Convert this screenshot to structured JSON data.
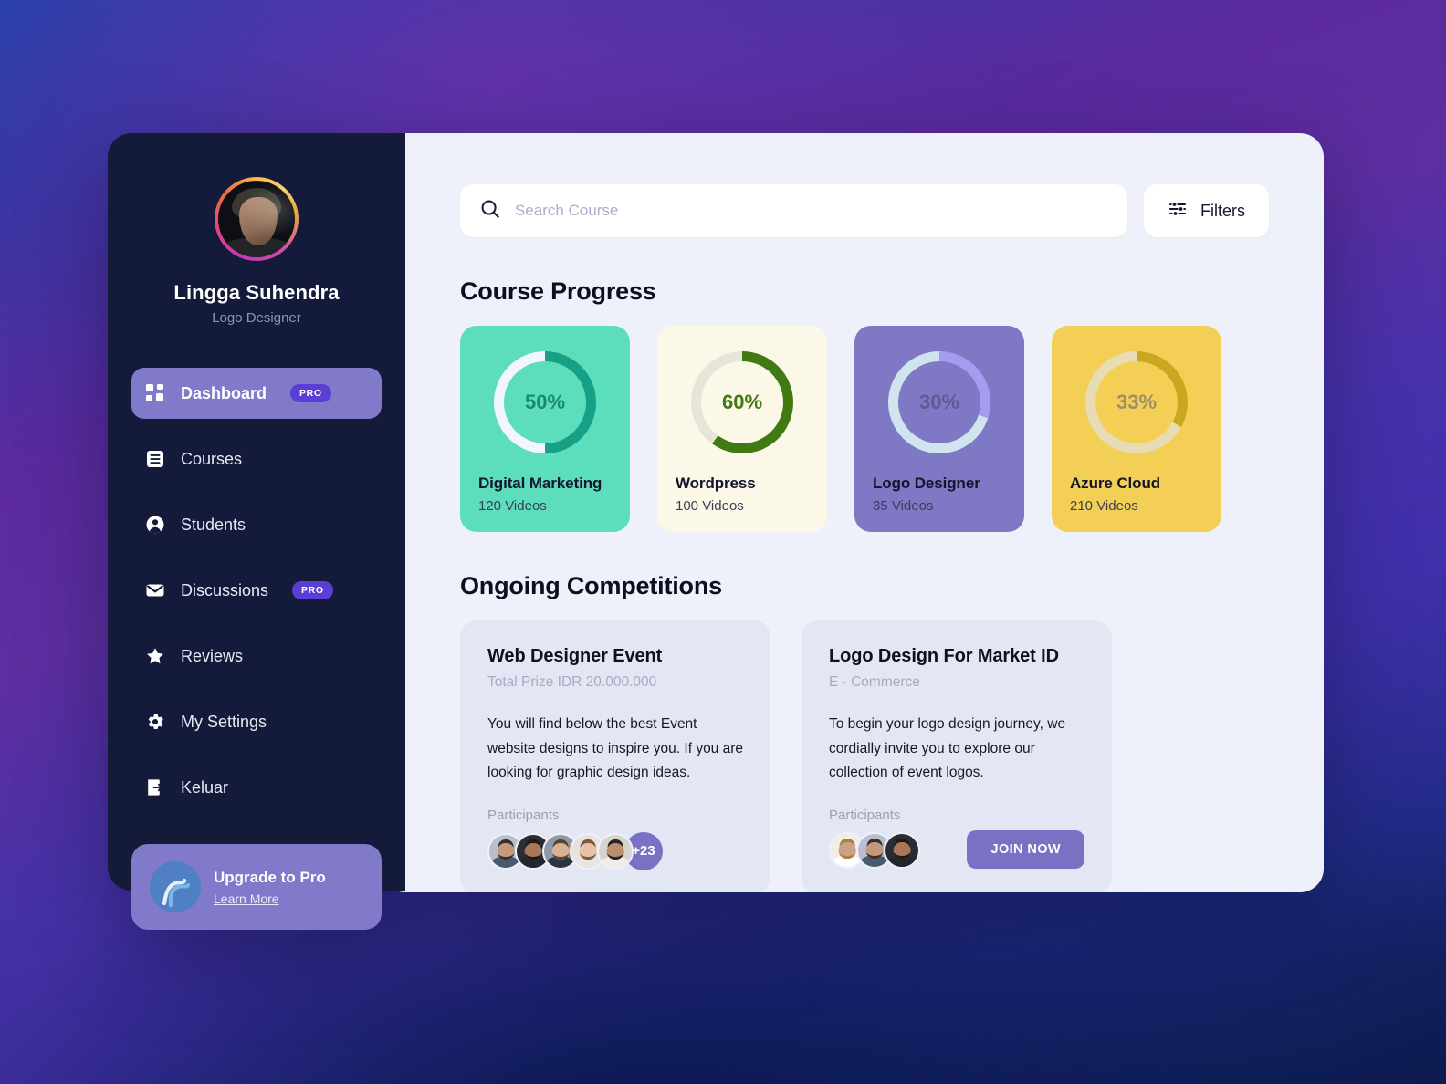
{
  "sidebar": {
    "profile": {
      "name": "Lingga Suhendra",
      "role": "Logo Designer",
      "avatar_icon": "user-avatar-photo"
    },
    "items": [
      {
        "label": "Dashboard",
        "icon": "grid-icon",
        "badge": "PRO",
        "active": true
      },
      {
        "label": "Courses",
        "icon": "list-icon",
        "badge": "",
        "active": false
      },
      {
        "label": "Students",
        "icon": "user-icon",
        "badge": "",
        "active": false
      },
      {
        "label": "Discussions",
        "icon": "envelope-icon",
        "badge": "PRO",
        "active": false
      },
      {
        "label": "Reviews",
        "icon": "star-icon",
        "badge": "",
        "active": false
      },
      {
        "label": "My Settings",
        "icon": "gear-icon",
        "badge": "",
        "active": false
      },
      {
        "label": "Keluar",
        "icon": "logout-icon",
        "badge": "",
        "active": false
      }
    ],
    "upgrade": {
      "title": "Upgrade to Pro",
      "link": "Learn More",
      "logo_icon": "wave-logo-icon"
    }
  },
  "topbar": {
    "search_placeholder": "Search Course",
    "search_value": "",
    "search_icon": "search-icon",
    "filters_label": "Filters",
    "filters_icon": "sliders-icon"
  },
  "course_progress": {
    "title": "Course Progress",
    "cards": [
      {
        "name": "Digital Marketing",
        "videos": "120 Videos",
        "percent_label": "50%",
        "percent": 50,
        "bg": "#5cddbb",
        "track": "#f2f5fb",
        "fill": "#16a085",
        "text": "#178a72"
      },
      {
        "name": "Wordpress",
        "videos": "100 Videos",
        "percent_label": "60%",
        "percent": 60,
        "bg": "#fcf8e8",
        "track": "#e7e4d8",
        "fill": "#417a12",
        "text": "#417a12"
      },
      {
        "name": "Logo Designer",
        "videos": "35 Videos",
        "percent_label": "30%",
        "percent": 30,
        "bg": "#7f78c4",
        "track": "#cfe4ee",
        "fill": "#a49cf0",
        "text": "#5f5a93"
      },
      {
        "name": "Azure Cloud",
        "videos": "210 Videos",
        "percent_label": "33%",
        "percent": 33,
        "bg": "#f3d055",
        "track": "#e7dcb4",
        "fill": "#c9a81f",
        "text": "#9b9069"
      }
    ]
  },
  "competitions": {
    "title": "Ongoing Competitions",
    "participants_label": "Participants",
    "cards": [
      {
        "title": "Web Designer Event",
        "subtitle": "Total Prize IDR 20.000.000",
        "description": "You will find below the best Event website designs to inspire you. If you are looking for graphic design ideas.",
        "avatars": 5,
        "more_count": "+23",
        "join_label": ""
      },
      {
        "title": "Logo Design For Market ID",
        "subtitle": "E - Commerce",
        "description": "To begin your logo design journey, we cordially invite you to explore our collection of event logos.",
        "avatars": 3,
        "more_count": "",
        "join_label": "JOIN NOW"
      }
    ]
  },
  "colors": {
    "sidebar_bg": "#141a3a",
    "main_bg": "#eef1fa",
    "accent": "#7a71c4",
    "pro_badge": "#5b3fd4"
  }
}
